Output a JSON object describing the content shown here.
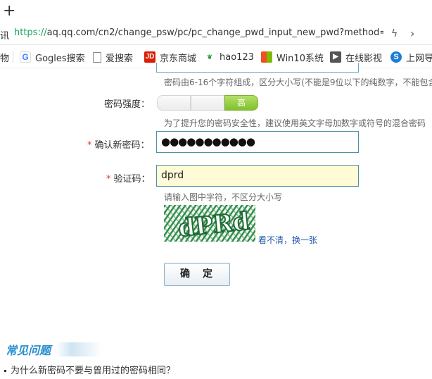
{
  "browser": {
    "new_tab": "+",
    "address_prefix": "讯",
    "url_scheme": "https://",
    "url_rest": "aq.qq.com/cn2/change_psw/pc/pc_change_pwd_input_new_pwd?method=18",
    "bookmarks": [
      {
        "label": "物",
        "icon": "folder-icon"
      },
      {
        "label": "Gogles搜索",
        "icon": "google-icon"
      },
      {
        "label": "爱搜索",
        "icon": "page-icon"
      },
      {
        "label": "京东商城",
        "icon": "jd-icon"
      },
      {
        "label": "hao123",
        "icon": "hao123-icon"
      },
      {
        "label": "Win10系统",
        "icon": "windows-icon"
      },
      {
        "label": "在线影视",
        "icon": "video-icon"
      },
      {
        "label": "上网导",
        "icon": "nav-icon"
      }
    ]
  },
  "form": {
    "password_hint": "密码由6-16个字符组成，区分大小写(不能是9位以下的纯数字，不能包含",
    "strength_label": "密码强度：",
    "strength_level": "高",
    "strength_hint": "为了提升您的密码安全性，建议使用英文字母加数字或符号的混合密码",
    "confirm_label": "确认新密码：",
    "confirm_value": "●●●●●●●●●●●",
    "captcha_label": "验证码：",
    "captcha_value": "dprd",
    "captcha_hint": "请输入图中字符，不区分大小写",
    "captcha_image_text": "dPRd",
    "refresh_link": "看不清，换一张",
    "submit_label": "确定",
    "required_mark": "*"
  },
  "faq": {
    "title": "常见问题",
    "items": [
      "为什么新密码不要与曾用过的密码相同？"
    ]
  },
  "colors": {
    "accent": "#2a8fd0",
    "input_border": "#4d93a8",
    "strength_high": "#7fc12e",
    "required": "#e4393c",
    "link": "#1f5aa5"
  }
}
